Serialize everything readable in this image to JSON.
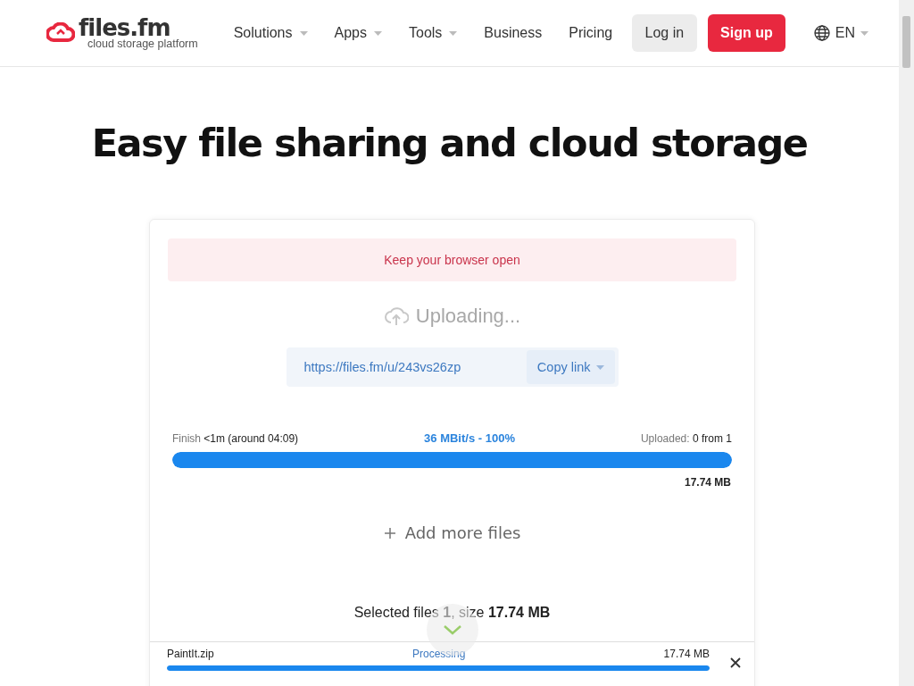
{
  "header": {
    "logo": {
      "name": "files.fm",
      "tagline": "cloud storage platform"
    },
    "nav": [
      {
        "label": "Solutions",
        "dropdown": true
      },
      {
        "label": "Apps",
        "dropdown": true
      },
      {
        "label": "Tools",
        "dropdown": true
      },
      {
        "label": "Business",
        "dropdown": false
      },
      {
        "label": "Pricing",
        "dropdown": false
      }
    ],
    "login": "Log in",
    "signup": "Sign up",
    "language": "EN"
  },
  "title": "Easy file sharing and cloud storage",
  "upload": {
    "alert": "Keep your browser open",
    "status": "Uploading...",
    "link": "https://files.fm/u/243vs26zp",
    "copy_button": "Copy link",
    "finish_label": "Finish",
    "finish_value": "<1m (around 04:09)",
    "speed": "36 MBit/s - 100%",
    "uploaded_label": "Uploaded:",
    "uploaded_value": "0 from 1",
    "level": 1,
    "total_size": "17.74 MB",
    "add_more": "Add more files",
    "summary": "Selected files **1**, size **17.74 MB**",
    "files": [
      {
        "name": "PaintIt.zip",
        "status": "Processing",
        "size": "17.74 MB",
        "level": 1
      }
    ]
  }
}
